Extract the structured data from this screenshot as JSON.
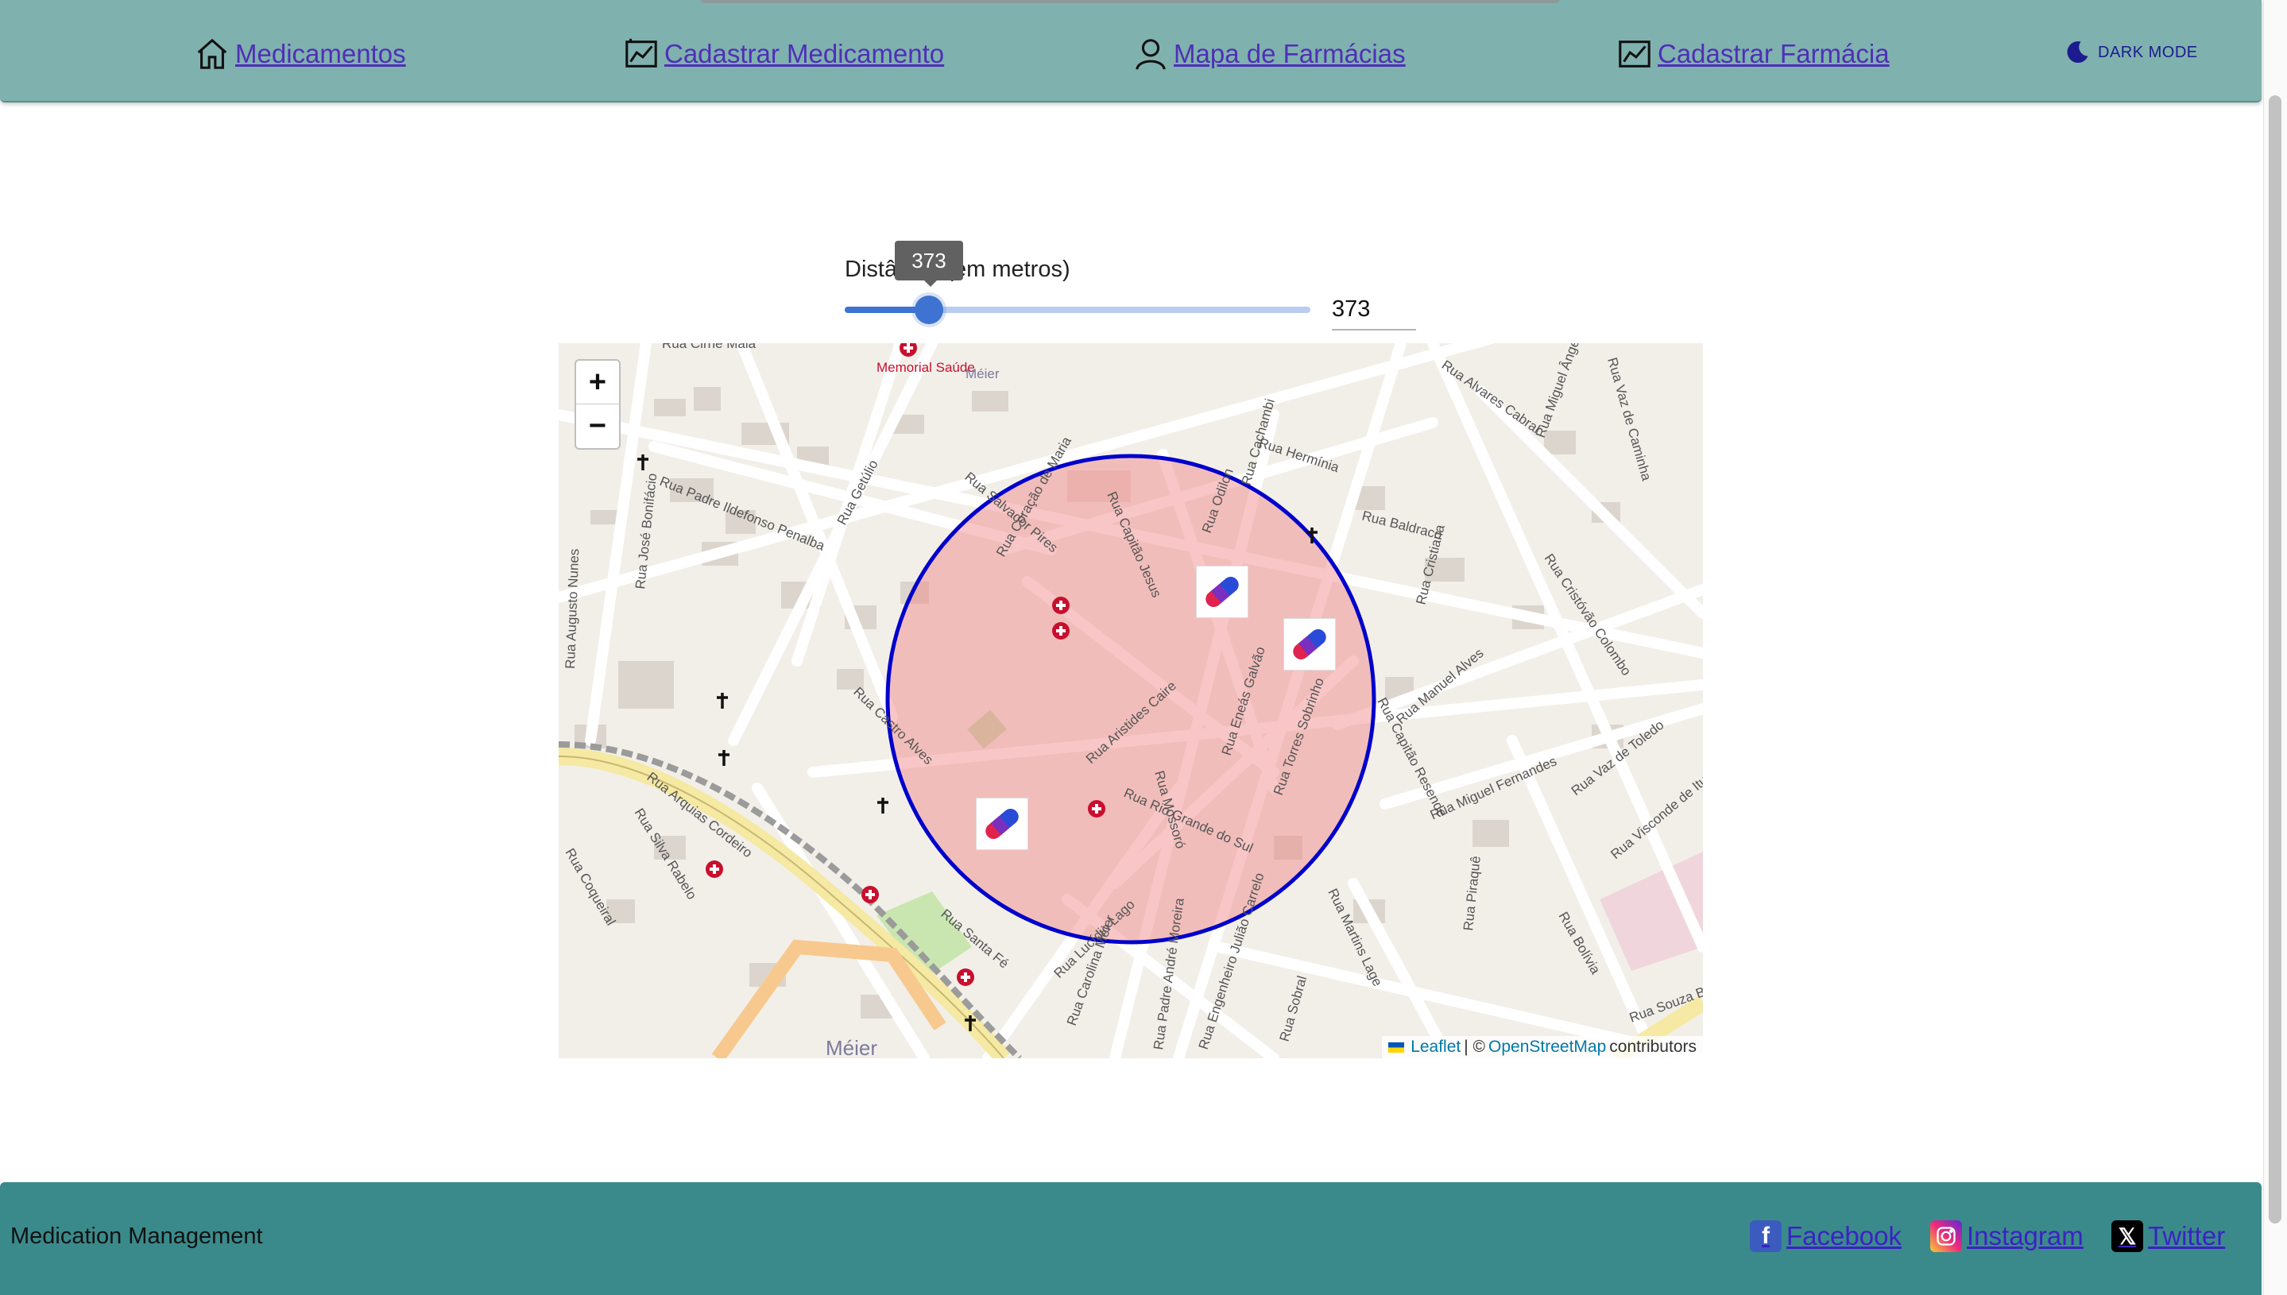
{
  "nav": {
    "items": [
      {
        "label": "Medicamentos",
        "icon": "home-icon"
      },
      {
        "label": "Cadastrar Medicamento",
        "icon": "chart-icon"
      },
      {
        "label": "Mapa de Farmácias",
        "icon": "person-icon"
      },
      {
        "label": "Cadastrar Farmácia",
        "icon": "chart-icon"
      }
    ],
    "dark_mode_label": "DARK MODE",
    "dark_mode_icon": "moon-icon"
  },
  "distance": {
    "label": "Distância (em metros)",
    "tooltip_value": "373",
    "input_value": "373",
    "slider_fraction": 0.18
  },
  "map": {
    "zoom_in": "+",
    "zoom_out": "−",
    "attribution": {
      "leaflet": "Leaflet",
      "separator": "| ©",
      "osm": "OpenStreetMap",
      "suffix": "contributors"
    },
    "pharmacy_marker_count": 3,
    "radius_color": "#0000cc",
    "radius_fill": "#f08080",
    "place_labels": [
      "Memorial Saúde",
      "Méier",
      "Méier"
    ],
    "street_labels": [
      "Rua Cirne Maia",
      "Rua José Bonifácio",
      "Rua Padre Ildefonso Penalba",
      "Rua Augusto Nunes",
      "Rua Getúlio",
      "Rua Salvador Pires",
      "Rua Coração de Maria",
      "Rua Capitão Jesus",
      "Rua Odilon",
      "Rua Cachambi",
      "Rua Hermínia",
      "Rua Alvares Cabral",
      "Rua Miguel Ângelo",
      "Rua Vaz de Caminha",
      "Rua Baldraco",
      "Rua Cristiana",
      "Rua Cristóvão Colombo",
      "Rua Manuel Alves",
      "Rua Aristides Caire",
      "Rua Mossoró",
      "Rua Eneás Galvão",
      "Rua Torres Sobrinho",
      "Rua Capitão Resende",
      "Rua Miguel Fernandes",
      "Rua Vaz de Toledo",
      "Rua Visconde de Itu",
      "Rua Castro Alves",
      "Rua Rio Grande do Sul",
      "Rua Arquias Cordeiro",
      "Rua Silva Rabelo",
      "Rua Coqueiral",
      "Rua Santa Fé",
      "Rua Lucídio Lago",
      "Rua Carolina Méier",
      "Rua Padre André Moreira",
      "Rua Engenheiro Julião Carrelo",
      "Rua Sobral",
      "Rua Martins Lage",
      "Rua Piraquê",
      "Rua Bolívia",
      "Rua Souza Barros",
      "Rua Aristides Caire"
    ]
  },
  "footer": {
    "title": "Medication Management",
    "links": [
      {
        "label": "Facebook",
        "icon": "facebook-icon",
        "color": "#3b5bbf"
      },
      {
        "label": "Instagram",
        "icon": "instagram-icon",
        "color": "#c13584"
      },
      {
        "label": "Twitter",
        "icon": "x-twitter-icon",
        "color": "#000000"
      }
    ]
  }
}
